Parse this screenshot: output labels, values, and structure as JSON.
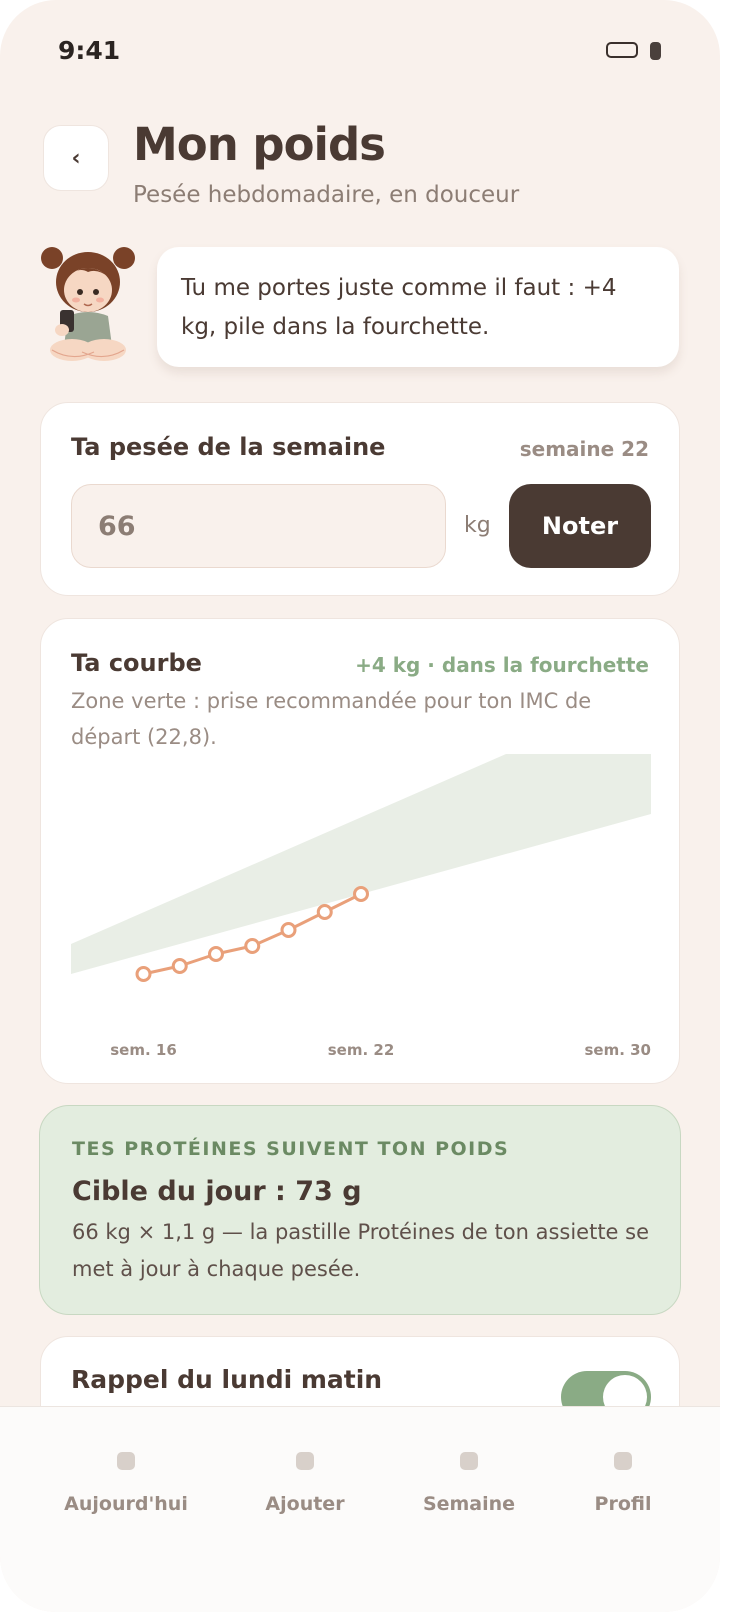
{
  "status": {
    "time": "9:41"
  },
  "header": {
    "back_label": "‹",
    "title": "Mon poids",
    "subtitle": "Pesée hebdomadaire, en douceur"
  },
  "bubble": {
    "text": "Tu me portes juste comme il faut : +4 kg, pile dans la fourchette."
  },
  "weigh": {
    "title": "Ta pesée de la semaine",
    "week": "semaine 22",
    "value": "66",
    "unit": "kg",
    "button": "Noter"
  },
  "curve": {
    "title": "Ta courbe",
    "status": "+4 kg · dans la fourchette",
    "description": "Zone verte : prise recommandée pour ton IMC de départ (22,8)."
  },
  "chart_data": {
    "type": "line",
    "x": [
      16,
      17,
      18,
      19,
      20,
      21,
      22
    ],
    "y": [
      62.0,
      62.4,
      63.0,
      63.4,
      64.2,
      65.1,
      66.0
    ],
    "xlim": [
      14,
      30
    ],
    "ylim": [
      60,
      72
    ],
    "band_lower": [
      {
        "x": 14,
        "y": 62.0
      },
      {
        "x": 30,
        "y": 70.0
      }
    ],
    "band_upper": [
      {
        "x": 14,
        "y": 63.5
      },
      {
        "x": 26,
        "y": 73.0
      },
      {
        "x": 30,
        "y": 73.0
      }
    ],
    "tick_labels": [
      {
        "x": 16,
        "label": "sem. 16"
      },
      {
        "x": 22,
        "label": "sem. 22"
      },
      {
        "x": 30,
        "label": "sem. 30"
      }
    ],
    "colors": {
      "line": "#e9a07a",
      "band": "#e9eee6"
    }
  },
  "protein": {
    "kicker": "TES PROTÉINES SUIVENT TON POIDS",
    "target": "Cible du jour : 73 g",
    "description": "66 kg × 1,1 g — la pastille Protéines de ton assiette se met à jour à chaque pesée."
  },
  "reminder": {
    "title": "Rappel du lundi matin",
    "enabled": true
  },
  "tabs": [
    {
      "label": "Aujourd'hui",
      "icon": "today-icon"
    },
    {
      "label": "Ajouter",
      "icon": "add-icon"
    },
    {
      "label": "Semaine",
      "icon": "week-icon"
    },
    {
      "label": "Profil",
      "icon": "profile-icon"
    }
  ]
}
